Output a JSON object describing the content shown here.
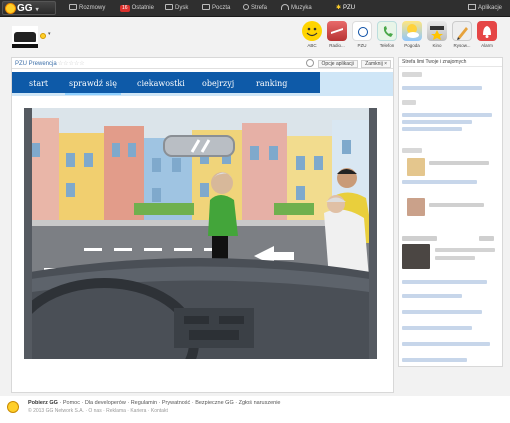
{
  "topbar": {
    "logo": "GG",
    "nav": [
      {
        "label": "Rozmowy"
      },
      {
        "label": "Ostatnie",
        "badge": "16"
      },
      {
        "label": "Dysk"
      },
      {
        "label": "Poczta"
      },
      {
        "label": "Strefa"
      },
      {
        "label": "Muzyka"
      },
      {
        "label": "PZU"
      }
    ],
    "apps_link": "Aplikacje"
  },
  "apps": [
    {
      "label": "ABC",
      "icon": "smiley-icon",
      "color": "#ffd400"
    },
    {
      "label": "Radio...",
      "icon": "radio-icon",
      "color": "#d64b4b"
    },
    {
      "label": "PZU",
      "icon": "pzu-icon",
      "color": "#0a4ea5"
    },
    {
      "label": "Telefon",
      "icon": "phone-icon",
      "color": "#6fc06a"
    },
    {
      "label": "Pogoda",
      "icon": "weather-icon",
      "color": "#b8dcff"
    },
    {
      "label": "Kino",
      "icon": "cinema-icon",
      "color": "#e0a400"
    },
    {
      "label": "Rysow...",
      "icon": "pencil-icon",
      "color": "#d9d9d9"
    },
    {
      "label": "Alarm",
      "icon": "bell-icon",
      "color": "#e54646"
    }
  ],
  "panel": {
    "title": "PZU Prewencja",
    "rating": "☆☆☆☆☆",
    "options_button": "Opcje aplikacji",
    "close_button": "Zamknij",
    "close_symbol": "×"
  },
  "app_nav": [
    "start",
    "sprawdź się",
    "ciekawostki",
    "obejrzyj",
    "ranking"
  ],
  "strefa": {
    "title": "Strefa limi Twoje i znajomych"
  },
  "footer": {
    "line1_bold": "Pobierz GG",
    "line1": "· Pomoc · Dla developerów · Regulamin · Prywatność · Bezpieczne GG · Zgłoś naruszenie",
    "line2": "© 2013 GG Network S.A. · O nas · Reklama · Kariera · Kontakt"
  },
  "colors": {
    "accent": "#0e5aa8",
    "topbar": "#2f2f2f",
    "badge": "#d9302c"
  }
}
